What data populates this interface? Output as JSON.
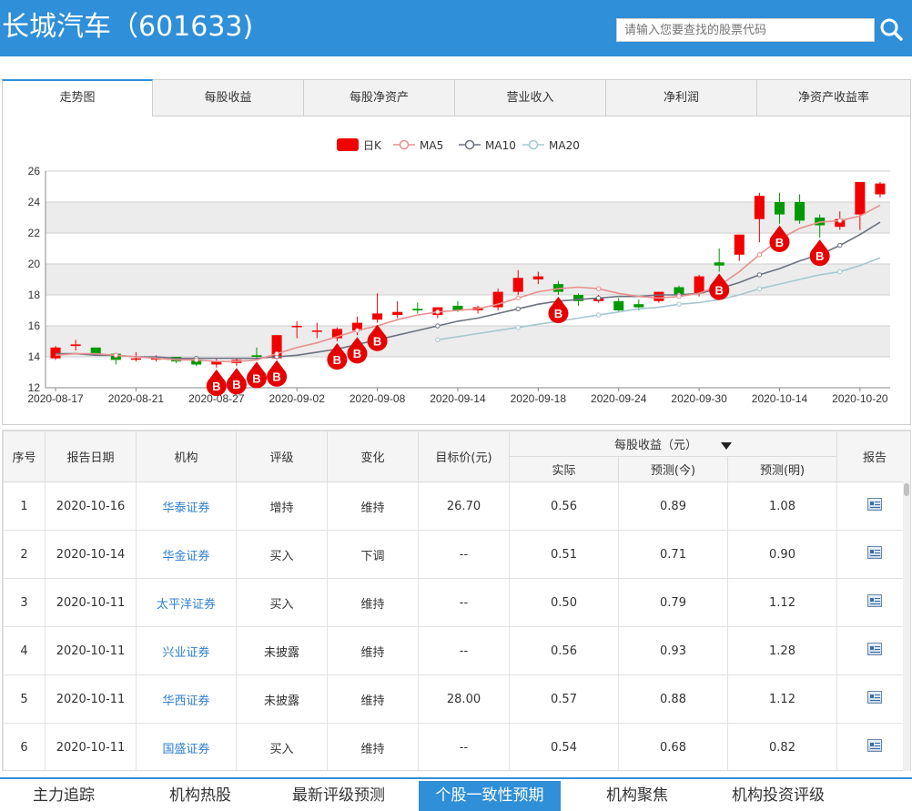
{
  "header": {
    "title": "长城汽车（601633)",
    "search_placeholder": "请输入您要查找的股票代码"
  },
  "tabs": [
    {
      "label": "走势图",
      "active": true
    },
    {
      "label": "每股收益"
    },
    {
      "label": "每股净资产"
    },
    {
      "label": "营业收入"
    },
    {
      "label": "净利润"
    },
    {
      "label": "净资产收益率"
    }
  ],
  "chart_data": {
    "type": "candlestick",
    "legend": [
      "日K",
      "MA5",
      "MA10",
      "MA20"
    ],
    "colors": {
      "up": "#f20000",
      "down": "#009a00",
      "ma5": "#e8908f",
      "ma10": "#6b7280",
      "ma20": "#a5c8cf",
      "buy_marker": "#e60000"
    },
    "ylim": [
      12,
      26
    ],
    "yticks": [
      12,
      14,
      16,
      18,
      20,
      22,
      24,
      26
    ],
    "xticks": [
      "2020-08-17",
      "2020-08-21",
      "2020-08-27",
      "2020-09-02",
      "2020-09-08",
      "2020-09-14",
      "2020-09-18",
      "2020-09-24",
      "2020-09-30",
      "2020-10-14",
      "2020-10-20"
    ],
    "candles": [
      {
        "o": 13.9,
        "c": 14.6,
        "h": 14.7,
        "l": 13.8
      },
      {
        "o": 14.7,
        "c": 14.8,
        "h": 15.1,
        "l": 14.4
      },
      {
        "o": 14.6,
        "c": 14.2,
        "h": 14.6,
        "l": 14.1
      },
      {
        "o": 14.2,
        "c": 13.8,
        "h": 14.2,
        "l": 13.5
      },
      {
        "o": 13.9,
        "c": 13.9,
        "h": 14.3,
        "l": 13.7
      },
      {
        "o": 13.9,
        "c": 13.9,
        "h": 14.1,
        "l": 13.7
      },
      {
        "o": 14.0,
        "c": 13.7,
        "h": 14.0,
        "l": 13.6
      },
      {
        "o": 13.8,
        "c": 13.5,
        "h": 13.8,
        "l": 13.4
      },
      {
        "o": 13.5,
        "c": 13.7,
        "h": 13.9,
        "l": 13.3
      },
      {
        "o": 13.6,
        "c": 13.8,
        "h": 13.9,
        "l": 13.4
      },
      {
        "o": 14.1,
        "c": 14.0,
        "h": 14.6,
        "l": 13.8
      },
      {
        "o": 13.9,
        "c": 15.4,
        "h": 15.4,
        "l": 13.9
      },
      {
        "o": 16.0,
        "c": 16.0,
        "h": 16.3,
        "l": 15.2
      },
      {
        "o": 15.7,
        "c": 15.7,
        "h": 16.2,
        "l": 15.2
      },
      {
        "o": 15.2,
        "c": 15.8,
        "h": 15.9,
        "l": 15.0
      },
      {
        "o": 15.7,
        "c": 16.2,
        "h": 16.6,
        "l": 15.4
      },
      {
        "o": 16.4,
        "c": 16.8,
        "h": 18.1,
        "l": 16.2
      },
      {
        "o": 16.7,
        "c": 16.9,
        "h": 17.6,
        "l": 16.5
      },
      {
        "o": 17.1,
        "c": 17.0,
        "h": 17.5,
        "l": 16.8
      },
      {
        "o": 16.7,
        "c": 17.2,
        "h": 17.2,
        "l": 16.5
      },
      {
        "o": 17.3,
        "c": 17.0,
        "h": 17.6,
        "l": 16.9
      },
      {
        "o": 17.0,
        "c": 17.2,
        "h": 17.3,
        "l": 16.8
      },
      {
        "o": 17.2,
        "c": 18.2,
        "h": 18.4,
        "l": 17.0
      },
      {
        "o": 18.2,
        "c": 19.1,
        "h": 19.6,
        "l": 18.0
      },
      {
        "o": 19.0,
        "c": 19.2,
        "h": 19.5,
        "l": 18.7
      },
      {
        "o": 18.7,
        "c": 18.2,
        "h": 18.9,
        "l": 18.0
      },
      {
        "o": 18.0,
        "c": 17.6,
        "h": 18.1,
        "l": 17.3
      },
      {
        "o": 17.6,
        "c": 17.8,
        "h": 18.0,
        "l": 17.5
      },
      {
        "o": 17.6,
        "c": 17.0,
        "h": 17.8,
        "l": 16.9
      },
      {
        "o": 17.4,
        "c": 17.2,
        "h": 17.7,
        "l": 17.0
      },
      {
        "o": 17.6,
        "c": 18.2,
        "h": 18.2,
        "l": 17.5
      },
      {
        "o": 18.5,
        "c": 18.0,
        "h": 18.6,
        "l": 17.8
      },
      {
        "o": 18.1,
        "c": 19.2,
        "h": 19.3,
        "l": 17.9
      },
      {
        "o": 20.1,
        "c": 19.9,
        "h": 21.0,
        "l": 19.5
      },
      {
        "o": 20.6,
        "c": 21.9,
        "h": 21.9,
        "l": 20.2
      },
      {
        "o": 22.9,
        "c": 24.4,
        "h": 24.6,
        "l": 21.4
      },
      {
        "o": 24.0,
        "c": 23.2,
        "h": 24.6,
        "l": 22.6
      },
      {
        "o": 24.0,
        "c": 22.8,
        "h": 24.5,
        "l": 22.6
      },
      {
        "o": 23.0,
        "c": 22.5,
        "h": 23.2,
        "l": 21.7
      },
      {
        "o": 22.4,
        "c": 22.9,
        "h": 23.4,
        "l": 22.2
      },
      {
        "o": 23.2,
        "c": 25.3,
        "h": 25.3,
        "l": 22.2
      },
      {
        "o": 24.5,
        "c": 25.2,
        "h": 25.3,
        "l": 24.3
      }
    ],
    "ma5": [
      14.1,
      14.2,
      14.2,
      14.1,
      14.0,
      13.9,
      13.8,
      13.8,
      13.7,
      13.7,
      13.8,
      14.2,
      14.6,
      14.9,
      15.3,
      15.7,
      16.0,
      16.4,
      16.7,
      16.9,
      17.0,
      17.1,
      17.4,
      17.8,
      18.2,
      18.4,
      18.5,
      18.4,
      18.1,
      17.9,
      17.8,
      17.9,
      18.1,
      18.6,
      19.5,
      20.6,
      21.6,
      22.3,
      22.7,
      22.8,
      23.1,
      23.8
    ],
    "ma10": [
      14.2,
      14.2,
      14.1,
      14.1,
      14.0,
      14.0,
      13.9,
      13.9,
      13.9,
      13.9,
      13.9,
      14.0,
      14.1,
      14.3,
      14.5,
      14.8,
      15.1,
      15.4,
      15.7,
      16.0,
      16.3,
      16.5,
      16.8,
      17.1,
      17.4,
      17.6,
      17.7,
      17.8,
      17.9,
      17.9,
      18.0,
      18.0,
      18.1,
      18.4,
      18.8,
      19.3,
      19.7,
      20.2,
      20.6,
      21.2,
      21.9,
      22.7
    ],
    "ma20": [
      null,
      null,
      null,
      null,
      null,
      null,
      null,
      null,
      null,
      null,
      null,
      null,
      null,
      null,
      null,
      null,
      null,
      null,
      null,
      15.1,
      15.3,
      15.5,
      15.7,
      15.9,
      16.1,
      16.3,
      16.5,
      16.7,
      16.9,
      17.1,
      17.2,
      17.4,
      17.5,
      17.7,
      18.0,
      18.4,
      18.7,
      19.0,
      19.3,
      19.5,
      19.9,
      20.4
    ],
    "buy_signals": [
      8,
      9,
      10,
      11,
      14,
      15,
      16,
      25,
      33,
      36,
      38
    ],
    "buy_label": "B"
  },
  "table": {
    "headers": {
      "seq": "序号",
      "date": "报告日期",
      "org": "机构",
      "rating": "评级",
      "change": "变化",
      "target": "目标价(元)",
      "eps": "每股收益（元）",
      "actual": "实际",
      "forecast_this": "预测(今)",
      "forecast_next": "预测(明)",
      "report": "报告"
    },
    "rows": [
      {
        "seq": "1",
        "date": "2020-10-16",
        "org": "华泰证券",
        "rating": "增持",
        "change": "维持",
        "target": "26.70",
        "actual": "0.56",
        "f1": "0.89",
        "f2": "1.08"
      },
      {
        "seq": "2",
        "date": "2020-10-14",
        "org": "华金证券",
        "rating": "买入",
        "change": "下调",
        "target": "--",
        "actual": "0.51",
        "f1": "0.71",
        "f2": "0.90"
      },
      {
        "seq": "3",
        "date": "2020-10-11",
        "org": "太平洋证券",
        "rating": "买入",
        "change": "维持",
        "target": "--",
        "actual": "0.50",
        "f1": "0.79",
        "f2": "1.12"
      },
      {
        "seq": "4",
        "date": "2020-10-11",
        "org": "兴业证券",
        "rating": "未披露",
        "change": "维持",
        "target": "--",
        "actual": "0.56",
        "f1": "0.93",
        "f2": "1.28"
      },
      {
        "seq": "5",
        "date": "2020-10-11",
        "org": "华西证券",
        "rating": "未披露",
        "change": "维持",
        "target": "28.00",
        "actual": "0.57",
        "f1": "0.88",
        "f2": "1.12"
      },
      {
        "seq": "6",
        "date": "2020-10-11",
        "org": "国盛证券",
        "rating": "买入",
        "change": "维持",
        "target": "--",
        "actual": "0.54",
        "f1": "0.68",
        "f2": "0.82"
      }
    ]
  },
  "bottom_nav": [
    {
      "label": "主力追踪"
    },
    {
      "label": "机构热股"
    },
    {
      "label": "最新评级预测"
    },
    {
      "label": "个股一致性预期",
      "active": true
    },
    {
      "label": "机构聚焦"
    },
    {
      "label": "机构投资评级"
    }
  ]
}
